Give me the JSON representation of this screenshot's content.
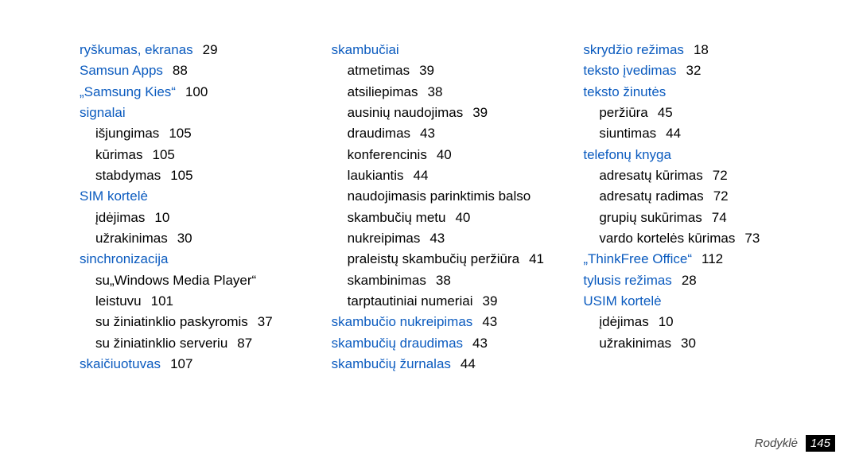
{
  "columns": [
    [
      {
        "type": "heading",
        "text": "ryškumas, ekranas",
        "page": "29"
      },
      {
        "type": "heading",
        "text": "Samsun Apps",
        "page": "88"
      },
      {
        "type": "heading",
        "text": "„Samsung Kies“",
        "page": "100"
      },
      {
        "type": "heading",
        "text": "signalai"
      },
      {
        "type": "sub",
        "text": "išjungimas",
        "page": "105"
      },
      {
        "type": "sub",
        "text": "kūrimas",
        "page": "105"
      },
      {
        "type": "sub",
        "text": "stabdymas",
        "page": "105"
      },
      {
        "type": "heading",
        "text": "SIM kortelė"
      },
      {
        "type": "sub",
        "text": "įdėjimas",
        "page": "10"
      },
      {
        "type": "sub",
        "text": "užrakinimas",
        "page": "30"
      },
      {
        "type": "heading",
        "text": "sinchronizacija"
      },
      {
        "type": "sub",
        "text": "su„Windows Media Player“ leistuvu",
        "page": "101"
      },
      {
        "type": "sub",
        "text": "su žiniatinklio paskyromis",
        "page": "37"
      },
      {
        "type": "sub",
        "text": "su žiniatinklio serveriu",
        "page": "87"
      },
      {
        "type": "heading",
        "text": "skaičiuotuvas",
        "page": "107"
      }
    ],
    [
      {
        "type": "heading",
        "text": "skambučiai"
      },
      {
        "type": "sub",
        "text": "atmetimas",
        "page": "39"
      },
      {
        "type": "sub",
        "text": "atsiliepimas",
        "page": "38"
      },
      {
        "type": "sub",
        "text": "ausinių naudojimas",
        "page": "39"
      },
      {
        "type": "sub",
        "text": "draudimas",
        "page": "43"
      },
      {
        "type": "sub",
        "text": "konferencinis",
        "page": "40"
      },
      {
        "type": "sub",
        "text": "laukiantis",
        "page": "44"
      },
      {
        "type": "sub",
        "text": "naudojimasis parinktimis balso skambučių metu",
        "page": "40"
      },
      {
        "type": "sub",
        "text": "nukreipimas",
        "page": "43"
      },
      {
        "type": "sub",
        "text": "praleistų skambučių peržiūra",
        "page": "41"
      },
      {
        "type": "sub",
        "text": "skambinimas",
        "page": "38"
      },
      {
        "type": "sub",
        "text": "tarptautiniai numeriai",
        "page": "39"
      },
      {
        "type": "heading",
        "text": "skambučio nukreipimas",
        "page": "43"
      },
      {
        "type": "heading",
        "text": "skambučių draudimas",
        "page": "43"
      },
      {
        "type": "heading",
        "text": "skambučių žurnalas",
        "page": "44"
      }
    ],
    [
      {
        "type": "heading",
        "text": "skrydžio režimas",
        "page": "18"
      },
      {
        "type": "heading",
        "text": "teksto įvedimas",
        "page": "32"
      },
      {
        "type": "heading",
        "text": "teksto žinutės"
      },
      {
        "type": "sub",
        "text": "peržiūra",
        "page": "45"
      },
      {
        "type": "sub",
        "text": "siuntimas",
        "page": "44"
      },
      {
        "type": "heading",
        "text": "telefonų knyga"
      },
      {
        "type": "sub",
        "text": "adresatų kūrimas",
        "page": "72"
      },
      {
        "type": "sub",
        "text": "adresatų radimas",
        "page": "72"
      },
      {
        "type": "sub",
        "text": "grupių sukūrimas",
        "page": "74"
      },
      {
        "type": "sub",
        "text": "vardo kortelės kūrimas",
        "page": "73"
      },
      {
        "type": "heading",
        "text": "„ThinkFree Office“",
        "page": "112"
      },
      {
        "type": "heading",
        "text": "tylusis režimas",
        "page": "28"
      },
      {
        "type": "heading",
        "text": "USIM kortelė"
      },
      {
        "type": "sub",
        "text": "įdėjimas",
        "page": "10"
      },
      {
        "type": "sub",
        "text": "užrakinimas",
        "page": "30"
      }
    ]
  ],
  "footer": {
    "label": "Rodyklė",
    "page": "145"
  }
}
